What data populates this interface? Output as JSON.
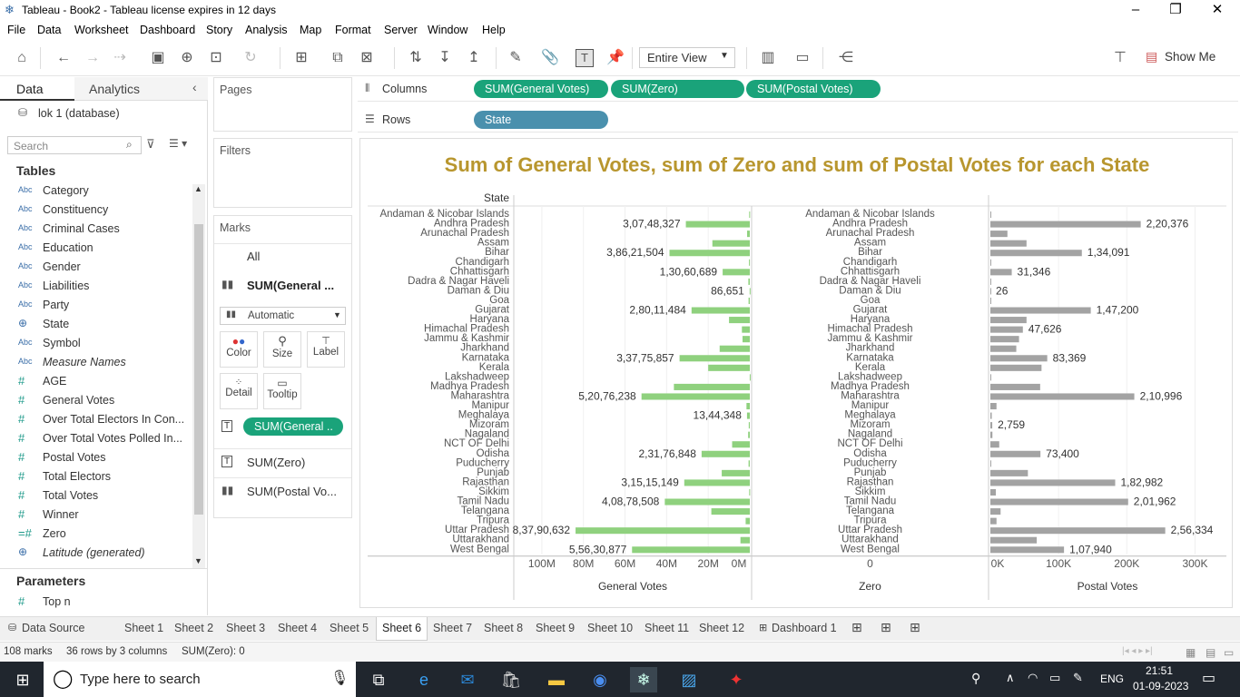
{
  "window": {
    "title": "Tableau - Book2 - Tableau license expires in 12 days"
  },
  "menu": [
    "File",
    "Data",
    "Worksheet",
    "Dashboard",
    "Story",
    "Analysis",
    "Map",
    "Format",
    "Server",
    "Window",
    "Help"
  ],
  "toolbar": {
    "view_mode": "Entire View",
    "show_me": "Show Me"
  },
  "left_pane": {
    "tab_data": "Data",
    "tab_analytics": "Analytics",
    "datasource": "lok 1 (database)",
    "search_placeholder": "Search",
    "tables_header": "Tables",
    "fields": [
      {
        "type": "Abc",
        "name": "Category"
      },
      {
        "type": "Abc",
        "name": "Constituency"
      },
      {
        "type": "Abc",
        "name": "Criminal Cases"
      },
      {
        "type": "Abc",
        "name": "Education"
      },
      {
        "type": "Abc",
        "name": "Gender"
      },
      {
        "type": "Abc",
        "name": "Liabilities"
      },
      {
        "type": "Abc",
        "name": "Party"
      },
      {
        "type": "geo",
        "name": "State"
      },
      {
        "type": "Abc",
        "name": "Symbol"
      },
      {
        "type": "Abc",
        "name": "Measure Names"
      },
      {
        "type": "#",
        "name": "AGE"
      },
      {
        "type": "#",
        "name": "General Votes"
      },
      {
        "type": "#",
        "name": "Over Total Electors  In Con..."
      },
      {
        "type": "#",
        "name": "Over Total Votes Polled  In..."
      },
      {
        "type": "#",
        "name": "Postal Votes"
      },
      {
        "type": "#",
        "name": "Total Electors"
      },
      {
        "type": "#",
        "name": "Total Votes"
      },
      {
        "type": "#",
        "name": "Winner"
      },
      {
        "type": "=#",
        "name": "Zero"
      },
      {
        "type": "geo",
        "name": "Latitude (generated)"
      }
    ],
    "parameters_header": "Parameters",
    "parameters": [
      {
        "type": "#",
        "name": "Top n"
      }
    ]
  },
  "cards": {
    "pages": "Pages",
    "filters": "Filters",
    "marks": "Marks",
    "marks_all": "All",
    "marks_general": "SUM(General ...",
    "mark_type": "Automatic",
    "buttons": [
      "Color",
      "Size",
      "Label",
      "Detail",
      "Tooltip"
    ],
    "label_pill": "SUM(General ..",
    "marks_zero": "SUM(Zero)",
    "marks_postal": "SUM(Postal Vo..."
  },
  "shelves": {
    "columns_label": "Columns",
    "rows_label": "Rows",
    "columns": [
      "SUM(General Votes)",
      "SUM(Zero)",
      "SUM(Postal Votes)"
    ],
    "rows": [
      "State"
    ]
  },
  "chart_data": {
    "type": "bar",
    "title": "Sum of General Votes, sum of Zero and sum of Postal Votes for each State",
    "row_header": "State",
    "categories": [
      "Andaman & Nicobar Islands",
      "Andhra Pradesh",
      "Arunachal Pradesh",
      "Assam",
      "Bihar",
      "Chandigarh",
      "Chhattisgarh",
      "Dadra & Nagar Haveli",
      "Daman & Diu",
      "Goa",
      "Gujarat",
      "Haryana",
      "Himachal Pradesh",
      "Jammu & Kashmir",
      "Jharkhand",
      "Karnataka",
      "Kerala",
      "Lakshadweep",
      "Madhya Pradesh",
      "Maharashtra",
      "Manipur",
      "Meghalaya",
      "Mizoram",
      "Nagaland",
      "NCT OF Delhi",
      "Odisha",
      "Puducherry",
      "Punjab",
      "Rajasthan",
      "Sikkim",
      "Tamil Nadu",
      "Telangana",
      "Tripura",
      "Uttar Pradesh",
      "Uttarakhand",
      "West Bengal"
    ],
    "series": [
      {
        "name": "General Votes",
        "color": "#8fd17e",
        "axis_ticks": [
          "100M",
          "80M",
          "60M",
          "40M",
          "20M",
          "0M"
        ],
        "reversed": true,
        "max": 110000000,
        "values": [
          300000,
          30748327,
          1300000,
          18000000,
          38621504,
          400000,
          13060689,
          700000,
          86651,
          600000,
          28011484,
          10000000,
          3800000,
          3500000,
          14500000,
          33775857,
          20000000,
          40000,
          36500000,
          52076238,
          1600000,
          1344348,
          500000,
          800000,
          8500000,
          23176848,
          600000,
          13500000,
          31515149,
          300000,
          40878508,
          18500000,
          2000000,
          83790632,
          4500000,
          56630877
        ],
        "labels": {
          "1": "3,07,48,327",
          "4": "3,86,21,504",
          "6": "1,30,60,689",
          "8": "86,651",
          "10": "2,80,11,484",
          "15": "3,37,75,857",
          "19": "5,20,76,238",
          "21": "13,44,348",
          "25": "2,31,76,848",
          "28": "3,15,15,149",
          "30": "4,08,78,508",
          "33": "8,37,90,632",
          "35": "5,56,30,877"
        }
      },
      {
        "name": "Zero",
        "color": "#aaaaaa",
        "axis_ticks": [
          "0"
        ],
        "values": [
          0,
          0,
          0,
          0,
          0,
          0,
          0,
          0,
          0,
          0,
          0,
          0,
          0,
          0,
          0,
          0,
          0,
          0,
          0,
          0,
          0,
          0,
          0,
          0,
          0,
          0,
          0,
          0,
          0,
          0,
          0,
          0,
          0,
          0,
          0,
          0
        ],
        "labels": {}
      },
      {
        "name": "Postal Votes",
        "color": "#a3a3a3",
        "axis_ticks": [
          "0K",
          "100K",
          "200K",
          "300K"
        ],
        "max": 330000,
        "values": [
          300,
          220376,
          25000,
          53000,
          134091,
          100,
          31346,
          100,
          26,
          1000,
          147200,
          53000,
          47626,
          42000,
          38000,
          83369,
          75000,
          100,
          73000,
          210996,
          9000,
          2000,
          2759,
          3000,
          13000,
          73400,
          1000,
          55000,
          182982,
          8000,
          201962,
          15000,
          9000,
          256334,
          68000,
          107940
        ],
        "labels": {
          "1": "2,20,376",
          "4": "1,34,091",
          "6": "31,346",
          "8": "26",
          "10": "1,47,200",
          "12": "47,626",
          "15": "83,369",
          "19": "2,10,996",
          "22": "2,759",
          "25": "73,400",
          "28": "1,82,982",
          "30": "2,01,962",
          "33": "2,56,334",
          "35": "1,07,940"
        }
      }
    ]
  },
  "sheet_tabs": {
    "data_source": "Data Source",
    "sheets": [
      "Sheet 1",
      "Sheet 2",
      "Sheet 3",
      "Sheet 4",
      "Sheet 5",
      "Sheet 6",
      "Sheet 7",
      "Sheet 8",
      "Sheet 9",
      "Sheet 10",
      "Sheet 11",
      "Sheet 12"
    ],
    "active": "Sheet 6",
    "dashboard": "Dashboard 1"
  },
  "status": {
    "marks": "108 marks",
    "rows_cols": "36 rows by 3 columns",
    "sum": "SUM(Zero): 0"
  },
  "taskbar": {
    "search_placeholder": "Type here to search",
    "lang": "ENG",
    "time": "21:51",
    "date": "01-09-2023"
  },
  "colors": {
    "accent_green": "#1aa37a",
    "row_pill_blue": "#4a90ad",
    "title_gold": "#b8962e",
    "general_bar": "#8fd17e",
    "postal_bar": "#a3a3a3"
  }
}
